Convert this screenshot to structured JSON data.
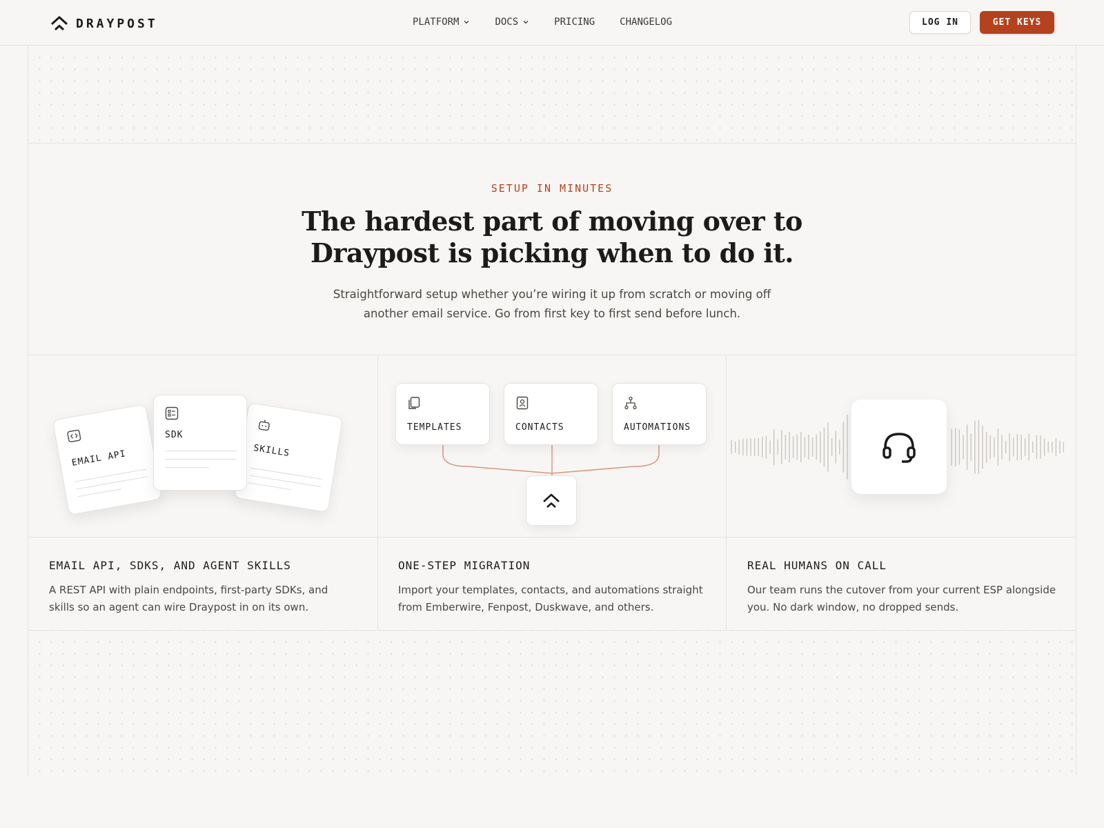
{
  "brand": {
    "name": "DRAYPOST"
  },
  "nav": {
    "links": [
      {
        "label": "PLATFORM",
        "dropdown": true
      },
      {
        "label": "DOCS",
        "dropdown": true
      },
      {
        "label": "PRICING",
        "dropdown": false
      },
      {
        "label": "CHANGELOG",
        "dropdown": false
      }
    ],
    "login_label": "LOG IN",
    "cta_label": "GET KEYS"
  },
  "hero": {
    "eyebrow": "SETUP IN MINUTES",
    "headline_line1": "The hardest part of moving over to",
    "headline_line2": "Draypost is picking when to do it.",
    "subhead_line1": "Straightforward setup whether you’re wiring it up from scratch or moving off",
    "subhead_line2": "another email service. Go from first key to first send before lunch."
  },
  "features": [
    {
      "illustration": {
        "cards": [
          {
            "label": "EMAIL API",
            "icon": "code-icon"
          },
          {
            "label": "SDK",
            "icon": "list-icon"
          },
          {
            "label": "SKILLS",
            "icon": "robot-icon"
          }
        ]
      },
      "title": "EMAIL API, SDKS, AND AGENT SKILLS",
      "desc_line1": "A REST API with plain endpoints, first-party SDKs, and",
      "desc_line2": "skills so an agent can wire Draypost in on its own."
    },
    {
      "illustration": {
        "sources": [
          {
            "label": "TEMPLATES",
            "icon": "copy-icon"
          },
          {
            "label": "CONTACTS",
            "icon": "contact-icon"
          },
          {
            "label": "AUTOMATIONS",
            "icon": "workflow-icon"
          }
        ],
        "target_icon": "draypost-logo-icon"
      },
      "title": "ONE-STEP MIGRATION",
      "desc_line1": "Import your templates, contacts, and automations straight",
      "desc_line2": "from Emberwire, Fenpost, Duskwave, and others."
    },
    {
      "illustration": {
        "icon": "headset-icon"
      },
      "title": "REAL HUMANS ON CALL",
      "desc_line1": "Our team runs the cutover from your current ESP alongside",
      "desc_line2": "you. No dark window, no dropped sends."
    }
  ],
  "colors": {
    "accent": "#b5421e",
    "background": "#f7f6f4",
    "text": "#1d1b19",
    "connector": "#d9967e"
  }
}
